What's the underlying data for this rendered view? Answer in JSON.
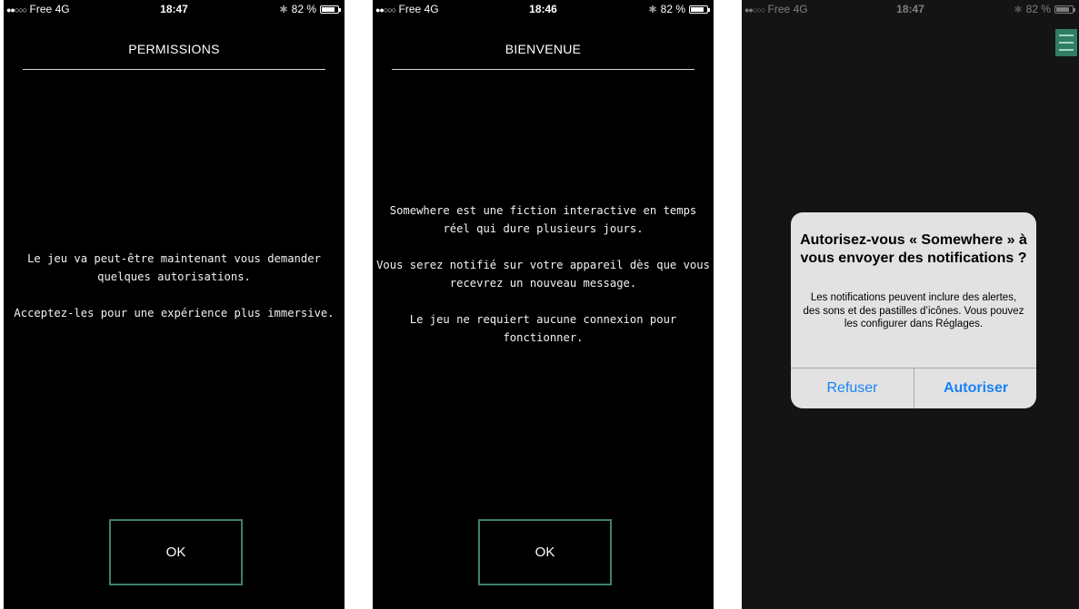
{
  "status_bars": [
    {
      "carrier": "Free",
      "network": "4G",
      "time": "18:47",
      "battery": "82 %",
      "battery_level": 0.82
    },
    {
      "carrier": "Free",
      "network": "4G",
      "time": "18:46",
      "battery": "82 %",
      "battery_level": 0.82
    },
    {
      "carrier": "Free",
      "network": "4G",
      "time": "18:47",
      "battery": "82 %",
      "battery_level": 0.82
    }
  ],
  "screen1": {
    "title": "PERMISSIONS",
    "paragraphs": [
      "Le jeu va peut-être maintenant vous demander quelques autorisations.",
      "Acceptez-les pour une expérience plus immersive."
    ],
    "button": "OK"
  },
  "screen2": {
    "title": "BIENVENUE",
    "paragraphs": [
      "Somewhere est une fiction interactive en temps réel qui dure plusieurs jours.",
      "Vous serez notifié sur votre appareil dès que vous recevrez un nouveau message.",
      "Le jeu ne requiert aucune connexion pour fonctionner."
    ],
    "button": "OK"
  },
  "screen3": {
    "menu_icon": "hamburger-menu-icon",
    "alert": {
      "title": "Autorisez-vous « Somewhere » à vous envoyer des notifications ?",
      "message": "Les notifications peuvent inclure des alertes, des sons et des pastilles d’icônes. Vous pouvez les configurer dans Réglages.",
      "refuse": "Refuser",
      "allow": "Autoriser"
    }
  },
  "colors": {
    "button_border": "#3f7f71",
    "menu_bg": "#2f7e64",
    "alert_bg": "#e2e2e2",
    "alert_button_text": "#1a82f7"
  }
}
